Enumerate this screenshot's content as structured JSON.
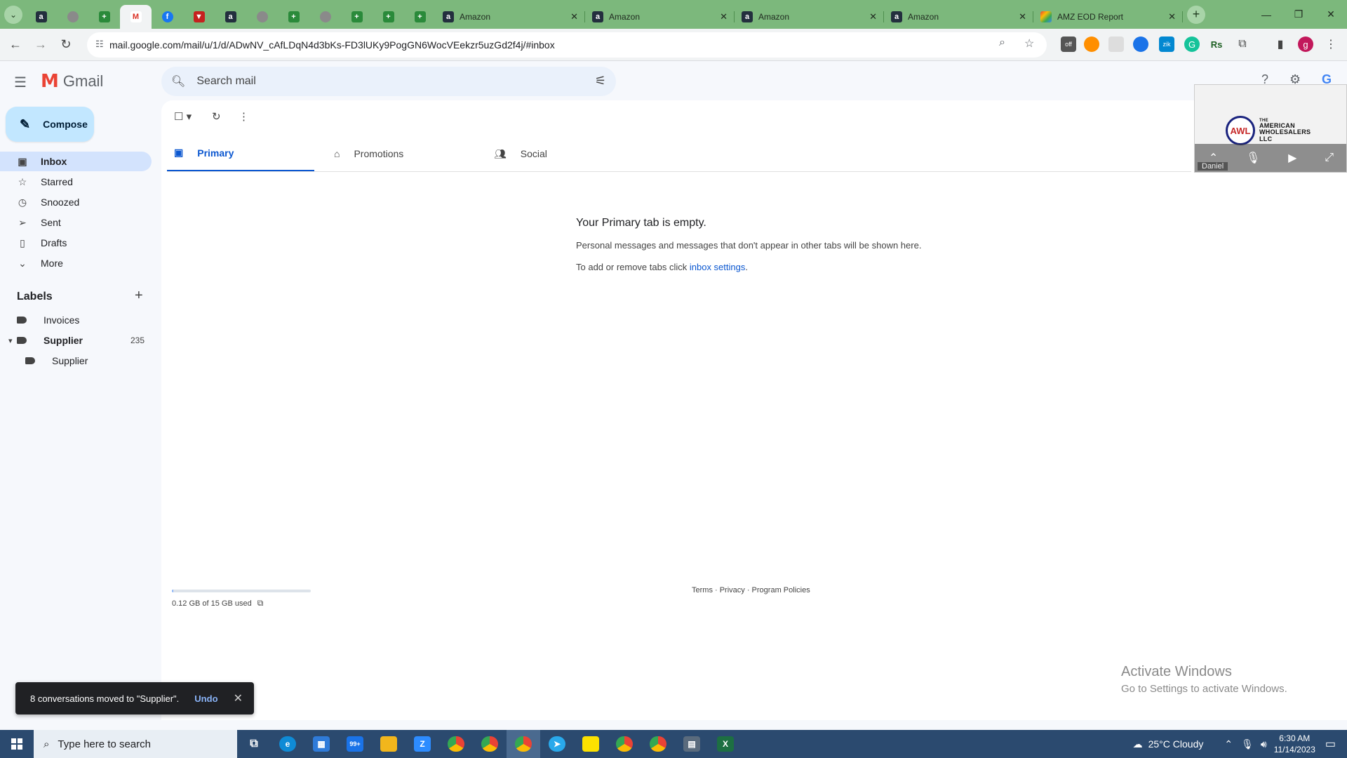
{
  "browser": {
    "pinned_tabs": [
      {
        "icon": "amazon-icon",
        "letter": "a",
        "kind": "amz"
      },
      {
        "icon": "generic-site-icon",
        "letter": "",
        "kind": "grey"
      },
      {
        "icon": "sheets-icon",
        "letter": "+",
        "kind": "green"
      },
      {
        "icon": "gmail-icon",
        "letter": "M",
        "kind": "gm",
        "active": true
      },
      {
        "icon": "facebook-icon",
        "letter": "f",
        "kind": "fb"
      },
      {
        "icon": "keepa-icon",
        "letter": "▼",
        "kind": "red"
      },
      {
        "icon": "amazon-icon",
        "letter": "a",
        "kind": "amz"
      },
      {
        "icon": "generic-site-icon",
        "letter": "",
        "kind": "grey"
      },
      {
        "icon": "sheets-icon",
        "letter": "+",
        "kind": "green"
      },
      {
        "icon": "generic-site-icon",
        "letter": "",
        "kind": "grey"
      },
      {
        "icon": "sheets-icon",
        "letter": "+",
        "kind": "green"
      },
      {
        "icon": "sheets-icon",
        "letter": "+",
        "kind": "green"
      },
      {
        "icon": "sheets-icon",
        "letter": "+",
        "kind": "green"
      }
    ],
    "tabs": [
      {
        "title": "Amazon",
        "icon": "amazon-icon",
        "letter": "a",
        "kind": "amz"
      },
      {
        "title": "Amazon",
        "icon": "amazon-icon",
        "letter": "a",
        "kind": "amz"
      },
      {
        "title": "Amazon",
        "icon": "amazon-icon",
        "letter": "a",
        "kind": "amz"
      },
      {
        "title": "Amazon",
        "icon": "amazon-icon",
        "letter": "a",
        "kind": "amz"
      },
      {
        "title": "AMZ EOD Report",
        "icon": "report-icon",
        "letter": "",
        "kind": "multi"
      }
    ],
    "url": "mail.google.com/mail/u/1/d/ADwNV_cAfLDqN4d3bKs-FD3lUKy9PogGN6WocVEekzr5uzGd2f4j/#inbox",
    "profile_initial": "g"
  },
  "gmail": {
    "brand": "Gmail",
    "search_placeholder": "Search mail",
    "compose_label": "Compose",
    "nav": [
      {
        "label": "Inbox",
        "icon": "inbox-icon",
        "active": true
      },
      {
        "label": "Starred",
        "icon": "star-icon"
      },
      {
        "label": "Snoozed",
        "icon": "clock-icon"
      },
      {
        "label": "Sent",
        "icon": "send-icon"
      },
      {
        "label": "Drafts",
        "icon": "draft-icon"
      },
      {
        "label": "More",
        "icon": "chevron-down-icon"
      }
    ],
    "labels_heading": "Labels",
    "labels": [
      {
        "label": "Invoices",
        "count": ""
      },
      {
        "label": "Supplier",
        "count": "235",
        "bold": true
      },
      {
        "label": "Supplier",
        "count": "",
        "nested": true
      }
    ],
    "tabs": [
      {
        "label": "Primary",
        "icon": "inbox-icon",
        "active": true
      },
      {
        "label": "Promotions",
        "icon": "tag-icon"
      },
      {
        "label": "Social",
        "icon": "people-icon"
      }
    ],
    "empty_title": "Your Primary tab is empty.",
    "empty_desc": "Personal messages and messages that don't appear in other tabs will be shown here.",
    "empty_settings_prefix": "To add or remove tabs click ",
    "empty_settings_link": "inbox settings",
    "empty_settings_suffix": ".",
    "storage_text": "0.12 GB of 15 GB used",
    "storage_fraction": 0.008,
    "footer_links": "Terms · Privacy · Program Policies",
    "snackbar_text": "8 conversations moved to \"Supplier\".",
    "snackbar_undo": "Undo"
  },
  "video_call": {
    "logo_letters": "AWL",
    "company_line1": "THE",
    "company_line2": "AMERICAN",
    "company_line3": "WHOLESALERS",
    "company_line4": "LLC",
    "participant": "Daniel"
  },
  "activate_windows": {
    "title": "Activate Windows",
    "subtitle": "Go to Settings to activate Windows."
  },
  "taskbar": {
    "search_placeholder": "Type here to search",
    "weather": "25°C  Cloudy",
    "time": "6:30 AM",
    "date": "11/14/2023",
    "badge_mail": "99+"
  }
}
